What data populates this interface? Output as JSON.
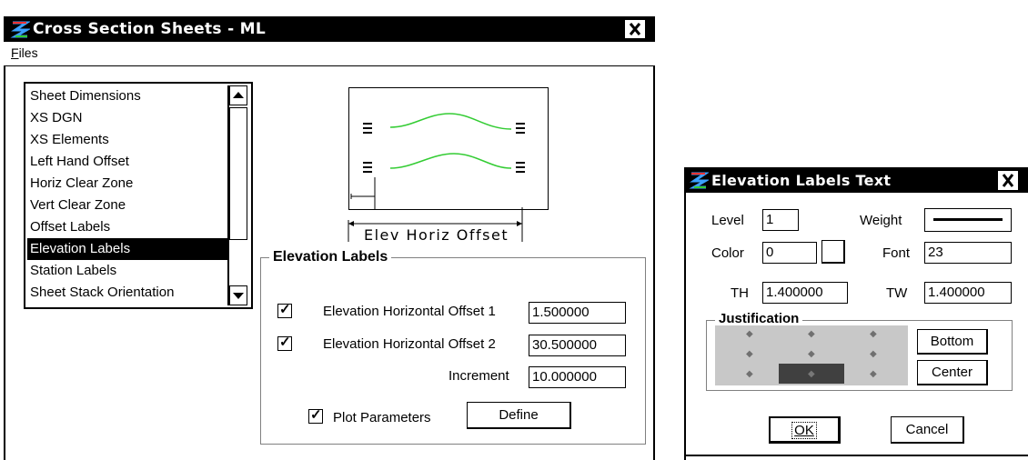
{
  "main_window": {
    "title": "Cross Section Sheets - ML",
    "menu": {
      "files": "Files"
    },
    "list": {
      "items": [
        "Sheet Dimensions",
        "XS DGN",
        "XS Elements",
        "Left Hand Offset",
        "Horiz Clear Zone",
        "Vert Clear Zone",
        "Offset Labels",
        "Elevation Labels",
        "Station Labels",
        "Sheet Stack Orientation"
      ],
      "selected": "Elevation Labels"
    },
    "preview": {
      "caption": "Elev Horiz Offset",
      "line_color": "#33cc33"
    },
    "group": {
      "title": "Elevation Labels",
      "offset1": {
        "label": "Elevation Horizontal Offset 1",
        "value": "1.500000",
        "checked": true
      },
      "offset2": {
        "label": "Elevation Horizontal Offset 2",
        "value": "30.500000",
        "checked": true
      },
      "increment": {
        "label": "Increment",
        "value": "10.000000"
      },
      "plot": {
        "label": "Plot Parameters",
        "checked": true
      },
      "define_button": "Define"
    }
  },
  "text_dialog": {
    "title": "Elevation Labels Text",
    "level": {
      "label": "Level",
      "value": "1"
    },
    "weight": {
      "label": "Weight"
    },
    "color": {
      "label": "Color",
      "value": "0"
    },
    "font": {
      "label": "Font",
      "value": "23"
    },
    "th": {
      "label": "TH",
      "value": "1.400000"
    },
    "tw": {
      "label": "TW",
      "value": "1.400000"
    },
    "justification": {
      "title": "Justification",
      "bottom_button": "Bottom",
      "center_button": "Center",
      "selected": "bottom-center"
    },
    "ok_button": "OK",
    "cancel_button": "Cancel"
  }
}
